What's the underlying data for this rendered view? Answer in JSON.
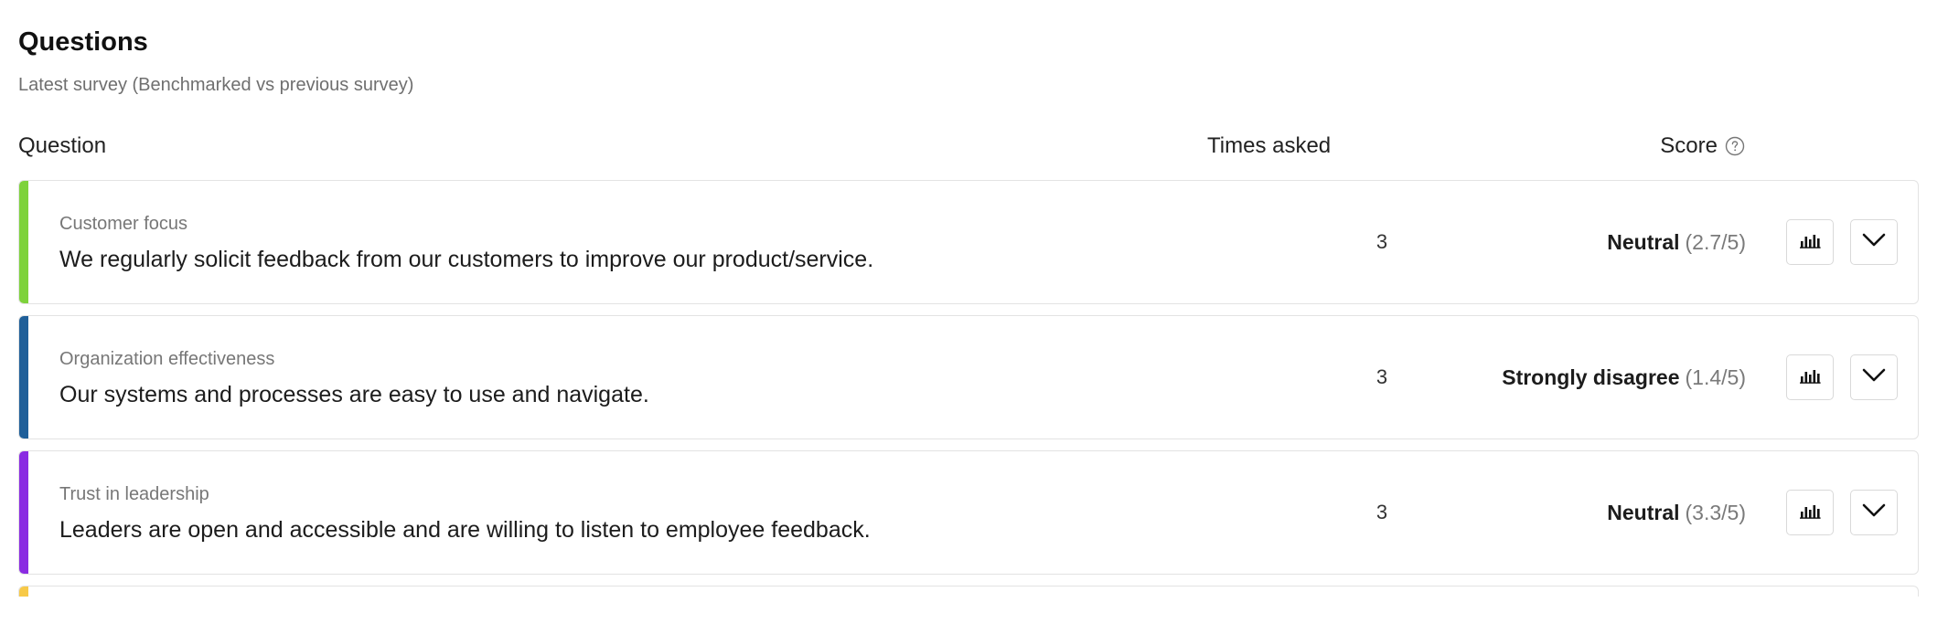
{
  "header": {
    "title": "Questions",
    "subtitle": "Latest survey (Benchmarked vs previous survey)"
  },
  "table": {
    "columns": {
      "question": "Question",
      "times_asked": "Times asked",
      "score": "Score"
    },
    "score_help_icon": "question-circle-icon",
    "row_actions": {
      "chart_icon": "bar-chart-icon",
      "expand_icon": "chevron-down-icon"
    },
    "rows": [
      {
        "category": "Customer focus",
        "question": "We regularly solicit feedback from our customers to improve our product/service.",
        "times_asked": "3",
        "score_label": "Neutral",
        "score_value": "(2.7/5)",
        "accent_color": "#7ed23b"
      },
      {
        "category": "Organization effectiveness",
        "question": "Our systems and processes are easy to use and navigate.",
        "times_asked": "3",
        "score_label": "Strongly disagree",
        "score_value": "(1.4/5)",
        "accent_color": "#1f5f99"
      },
      {
        "category": "Trust in leadership",
        "question": "Leaders are open and accessible and are willing to listen to employee feedback.",
        "times_asked": "3",
        "score_label": "Neutral",
        "score_value": "(3.3/5)",
        "accent_color": "#8a2be2"
      }
    ],
    "partial_row_accent_color": "#f7c948"
  }
}
